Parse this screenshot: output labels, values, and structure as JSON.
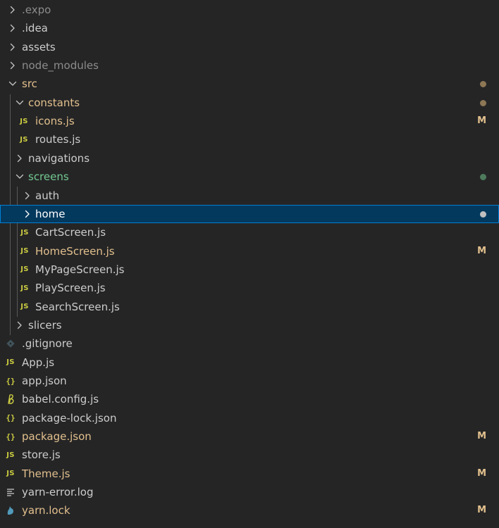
{
  "colors": {
    "default_text": "#cccccc",
    "ignored_text": "#8c8c8c",
    "modified_text": "#e2c08d",
    "untracked_text": "#73c991",
    "selected_text": "#ffffff",
    "dot_modified": "#8d7755",
    "dot_untracked": "#4e7b5c",
    "dot_selected": "#c0c0c0",
    "js_yellow": "#cbcb41"
  },
  "tree": [
    {
      "label": ".expo",
      "kind": "folder",
      "state": "collapsed",
      "depth": 0,
      "text": "ignored"
    },
    {
      "label": ".idea",
      "kind": "folder",
      "state": "collapsed",
      "depth": 0,
      "text": "default"
    },
    {
      "label": "assets",
      "kind": "folder",
      "state": "collapsed",
      "depth": 0,
      "text": "default"
    },
    {
      "label": "node_modules",
      "kind": "folder",
      "state": "collapsed",
      "depth": 0,
      "text": "ignored"
    },
    {
      "label": "src",
      "kind": "folder",
      "state": "expanded",
      "depth": 0,
      "text": "modified",
      "dot": "modified"
    },
    {
      "label": "constants",
      "kind": "folder",
      "state": "expanded",
      "depth": 1,
      "text": "modified",
      "dot": "modified"
    },
    {
      "label": "icons.js",
      "kind": "file",
      "icon": "js-file-icon",
      "depth": 1,
      "text": "modified",
      "status": "M"
    },
    {
      "label": "routes.js",
      "kind": "file",
      "icon": "js-file-icon",
      "depth": 1,
      "text": "default"
    },
    {
      "label": "navigations",
      "kind": "folder",
      "state": "collapsed",
      "depth": 1,
      "text": "default"
    },
    {
      "label": "screens",
      "kind": "folder",
      "state": "expanded",
      "depth": 1,
      "text": "untracked",
      "dot": "untracked"
    },
    {
      "label": "auth",
      "kind": "folder",
      "state": "collapsed",
      "depth": 2,
      "text": "default"
    },
    {
      "label": "home",
      "kind": "folder",
      "state": "collapsed",
      "depth": 2,
      "text": "selected",
      "dot": "selected",
      "selected": true
    },
    {
      "label": "CartScreen.js",
      "kind": "file",
      "icon": "js-file-icon",
      "depth": 2,
      "text": "default"
    },
    {
      "label": "HomeScreen.js",
      "kind": "file",
      "icon": "js-file-icon",
      "depth": 2,
      "text": "modified",
      "status": "M"
    },
    {
      "label": "MyPageScreen.js",
      "kind": "file",
      "icon": "js-file-icon",
      "depth": 2,
      "text": "default"
    },
    {
      "label": "PlayScreen.js",
      "kind": "file",
      "icon": "js-file-icon",
      "depth": 2,
      "text": "default"
    },
    {
      "label": "SearchScreen.js",
      "kind": "file",
      "icon": "js-file-icon",
      "depth": 2,
      "text": "default"
    },
    {
      "label": "slicers",
      "kind": "folder",
      "state": "collapsed",
      "depth": 1,
      "text": "default"
    },
    {
      "label": ".gitignore",
      "kind": "file",
      "icon": "git-icon",
      "depth": 0,
      "text": "default"
    },
    {
      "label": "App.js",
      "kind": "file",
      "icon": "js-file-icon",
      "depth": 0,
      "text": "default"
    },
    {
      "label": "app.json",
      "kind": "file",
      "icon": "json-braces-icon",
      "depth": 0,
      "text": "default"
    },
    {
      "label": "babel.config.js",
      "kind": "file",
      "icon": "babel-icon",
      "depth": 0,
      "text": "default"
    },
    {
      "label": "package-lock.json",
      "kind": "file",
      "icon": "json-braces-icon",
      "depth": 0,
      "text": "default"
    },
    {
      "label": "package.json",
      "kind": "file",
      "icon": "json-braces-icon",
      "depth": 0,
      "text": "modified",
      "status": "M"
    },
    {
      "label": "store.js",
      "kind": "file",
      "icon": "js-file-icon",
      "depth": 0,
      "text": "default"
    },
    {
      "label": "Theme.js",
      "kind": "file",
      "icon": "js-file-icon",
      "depth": 0,
      "text": "modified",
      "status": "M"
    },
    {
      "label": "yarn-error.log",
      "kind": "file",
      "icon": "log-lines-icon",
      "depth": 0,
      "text": "default"
    },
    {
      "label": "yarn.lock",
      "kind": "file",
      "icon": "yarn-icon",
      "depth": 0,
      "text": "modified",
      "status": "M"
    }
  ]
}
